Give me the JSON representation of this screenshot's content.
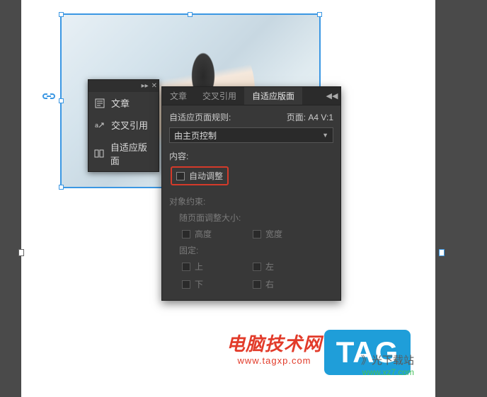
{
  "flyout": {
    "items": [
      {
        "label": "文章",
        "icon": "article"
      },
      {
        "label": "交叉引用",
        "icon": "crossref"
      },
      {
        "label": "自适应版面",
        "icon": "liquid"
      }
    ]
  },
  "panel": {
    "tabs": [
      {
        "label": "文章",
        "active": false
      },
      {
        "label": "交叉引用",
        "active": false
      },
      {
        "label": "自适应版面",
        "active": true
      }
    ],
    "rule_label": "自适应页面规则:",
    "page_label": "页面:",
    "page_value": "A4 V:1",
    "rule_dropdown_value": "由主页控制",
    "content_label": "内容:",
    "auto_adjust_label": "自动调整",
    "constraints_label": "对象约束:",
    "resize_with_page_label": "随页面调整大小:",
    "fixed_label": "固定:",
    "checkboxes": {
      "height": "高度",
      "width": "宽度",
      "top": "上",
      "left": "左",
      "bottom": "下",
      "right": "右"
    }
  },
  "watermarks": {
    "site1_title": "电脑技术网",
    "site1_url": "www.tagxp.com",
    "tag_badge": "TAG",
    "site2_title": "》光下载站",
    "site2_url": "www.xz7.com"
  }
}
